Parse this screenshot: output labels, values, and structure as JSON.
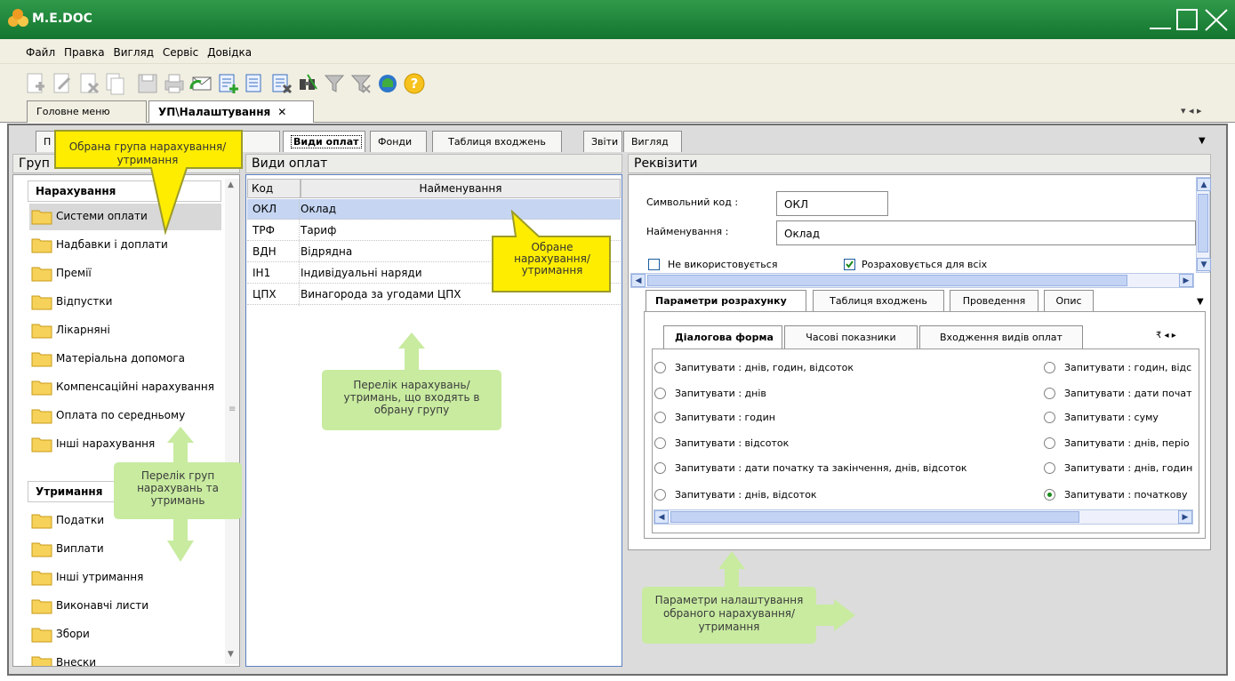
{
  "app": {
    "title": "M.E.DOC"
  },
  "colors": {
    "titlebar": "#1f8a3c",
    "workarea": "#dcdcdc",
    "selection": "#c5d5f2",
    "callout_yellow": "#ffed00",
    "callout_green": "#c8eba0"
  },
  "menu": [
    "Файл",
    "Правка",
    "Вигляд",
    "Сервіс",
    "Довідка"
  ],
  "toolbar_icons": [
    "add-doc-icon",
    "edit-doc-icon",
    "delete-doc-icon",
    "copy-doc-icon",
    "save-icon",
    "print-icon",
    "send-email-icon",
    "import-icon",
    "list-icon",
    "export-icon",
    "find-icon",
    "filter-icon",
    "clear-filter-icon",
    "update-icon",
    "help-icon"
  ],
  "doc_tabs": {
    "home": "Головне меню",
    "current": "УП\\Налаштування"
  },
  "inner_tabs": [
    "П",
    "ки",
    "Види оплат",
    "Фонди",
    "Таблиця входжень",
    "Звіти",
    "Вигляд"
  ],
  "left": {
    "header": "Груп",
    "group1": "Нарахування",
    "group1_items": [
      "Системи оплати",
      "Надбавки і доплати",
      "Премії",
      "Відпустки",
      "Лікарняні",
      "Матеріальна допомога",
      "Компенсаційні нарахування",
      "Оплата по середньому",
      "Інші нарахування"
    ],
    "group2": "Утримання",
    "group2_items": [
      "Податки",
      "Виплати",
      "Інші утримання",
      "Виконавчі листи",
      "Збори",
      "Внески"
    ]
  },
  "center": {
    "header": "Види оплат",
    "col_code": "Код",
    "col_name": "Найменування",
    "rows": [
      {
        "code": "ОКЛ",
        "name": "Оклад"
      },
      {
        "code": "ТРФ",
        "name": "Тариф"
      },
      {
        "code": "ВДН",
        "name": "Відрядна"
      },
      {
        "code": "ІН1",
        "name": "Індивідуальні наряди"
      },
      {
        "code": "ЦПХ",
        "name": "Винагорода за угодами ЦПХ"
      }
    ]
  },
  "right": {
    "header": "Реквізити",
    "code_label": "Символьний код :",
    "code_value": "ОКЛ",
    "name_label": "Найменування :",
    "name_value": "Оклад",
    "unused_label": "Не використовується",
    "unused_checked": false,
    "allcalc_label": "Розраховується для всіх",
    "allcalc_checked": true,
    "tabs": [
      "Параметри розрахунку",
      "Таблиця входжень",
      "Проведення",
      "Опис"
    ],
    "subtabs": [
      "Діалогова форма",
      "Часові показники",
      "Входження видів оплат"
    ],
    "radios_left": [
      "Запитувати : днів, годин, відсоток",
      "Запитувати : днів",
      "Запитувати : годин",
      "Запитувати : відсоток",
      "Запитувати : дати початку та закінчення, днів, відсоток",
      "Запитувати : днів, відсоток"
    ],
    "radios_right": [
      "Запитувати : годин, відс",
      "Запитувати : дати почат",
      "Запитувати : суму",
      "Запитувати : днів, періо",
      "Запитувати : днів, годин",
      "Запитувати : початкову"
    ],
    "selected_radio": "Запитувати : початкову"
  },
  "callouts": {
    "group_selected": "Обрана група нарахування/утримання",
    "item_selected": "Обране нарахування/ утримання",
    "items_list": "Перелік нарахувань/утримань, що входять в обрану групу",
    "groups_list": "Перелік груп нарахувань та утримань",
    "params": "Параметри налаштування обраного нарахування/утримання"
  }
}
